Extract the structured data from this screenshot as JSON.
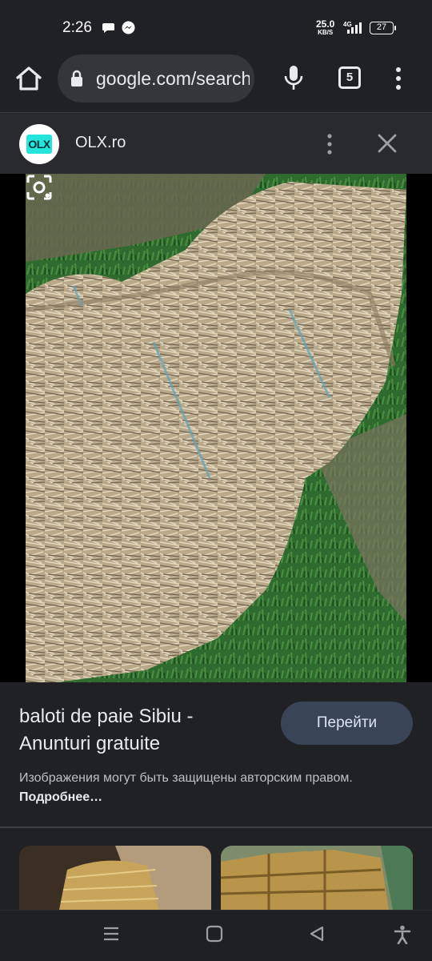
{
  "status_bar": {
    "time": "2:26",
    "net_speed": "25.0",
    "net_unit": "KB/S",
    "network_type": "4G",
    "battery": "27",
    "icons": [
      "chat-bubble-icon",
      "messenger-icon",
      "signal-icon",
      "battery-icon"
    ]
  },
  "toolbar": {
    "url": "google.com/search",
    "tab_count": "5",
    "icons": [
      "home-icon",
      "lock-icon",
      "mic-icon",
      "tabs-icon",
      "more-vert-icon"
    ]
  },
  "source": {
    "logo_text": "OLX",
    "name": "OLX.ro"
  },
  "result": {
    "title": "baloti de paie Sibiu - Anunturi gratuite",
    "visit_button": "Перейти",
    "notice": "Изображения могут быть защищены авторским правом.",
    "notice_link": "Подробнее…"
  },
  "colors": {
    "background": "#202124",
    "button_bg": "#394457",
    "olx_teal": "#23e5db"
  },
  "navigation_bar": {
    "icons": [
      "recents-icon",
      "home-circle-icon",
      "back-icon",
      "accessibility-icon"
    ]
  }
}
